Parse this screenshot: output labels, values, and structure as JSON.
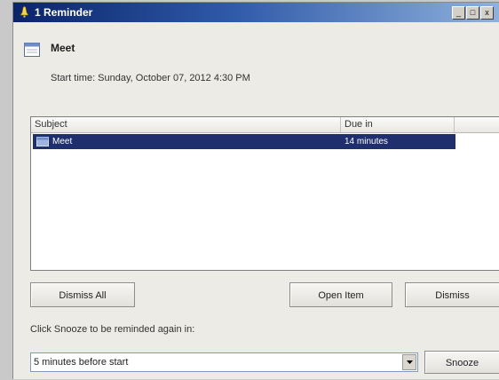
{
  "window": {
    "title": "1 Reminder",
    "controls": {
      "minimize": "_",
      "maximize": "□",
      "close": "x"
    }
  },
  "appointment": {
    "subject": "Meet",
    "start_time": "Start time: Sunday, October 07, 2012 4:30 PM"
  },
  "reminders_list": {
    "columns": {
      "subject": "Subject",
      "due_in": "Due in"
    },
    "rows": [
      {
        "subject": "Meet",
        "due_in": "14 minutes",
        "selected": true
      }
    ]
  },
  "buttons": {
    "dismiss_all": "Dismiss All",
    "open_item": "Open Item",
    "dismiss": "Dismiss",
    "snooze": "Snooze"
  },
  "snooze": {
    "prompt": "Click Snooze to be reminded again in:",
    "selected_option": "5 minutes before start"
  },
  "colors": {
    "titlebar_start": "#0a246a",
    "titlebar_end": "#8fb1dc",
    "selection": "#1f2f6e",
    "window_bg": "#ecebe6"
  },
  "icons": {
    "title": "bell-icon",
    "appointment": "calendar-icon",
    "row": "calendar-icon",
    "dropdown": "chevron-down-icon"
  }
}
